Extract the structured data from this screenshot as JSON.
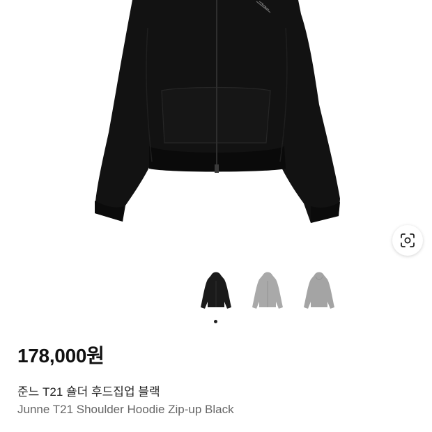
{
  "product": {
    "price": "178,000원",
    "name_ko": "준느 T21 숄더 후드집업 블랙",
    "name_en": "Junne T21 Shoulder Hoodie Zip-up Black"
  },
  "gallery": {
    "main_image": "hoodie-black-zipup",
    "thumbnails": [
      {
        "name": "hoodie-black",
        "color": "#1a1a1a"
      },
      {
        "name": "hoodie-gray",
        "color": "#a9a9a9"
      },
      {
        "name": "hoodie-gray-front",
        "color": "#a4a4a4"
      }
    ],
    "selected_index": 0,
    "lens_icon": "visual-search-icon"
  },
  "colors": {
    "hoodie_black": "#121212",
    "hoodie_gray": "#a9a9a9",
    "price_text": "#111111",
    "subtitle_text": "#666666"
  }
}
